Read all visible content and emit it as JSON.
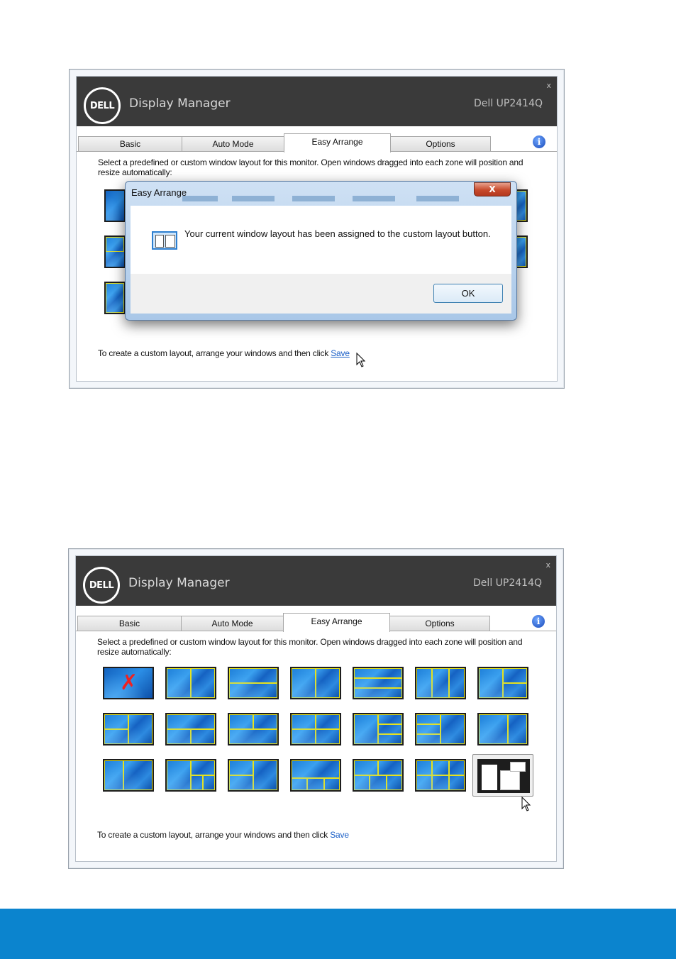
{
  "app": {
    "logo_text": "DELL",
    "title": "Display Manager",
    "model": "Dell UP2414Q",
    "close_glyph": "x"
  },
  "tabs": [
    {
      "label": "Basic"
    },
    {
      "label": "Auto Mode"
    },
    {
      "label": "Easy Arrange",
      "active": true
    },
    {
      "label": "Options"
    }
  ],
  "info_glyph": "i",
  "easy_arrange": {
    "description": "Select a predefined or custom window layout for this monitor. Open windows dragged into each zone will position and resize automatically:",
    "hint_prefix": "To create a custom layout, arrange your windows and then click ",
    "save_link": "Save"
  },
  "dialog": {
    "title": "Easy Arrange",
    "close_glyph": "X",
    "message": "Your current window layout has been assigned to the custom layout button.",
    "ok_label": "OK"
  },
  "layout_icons": [
    "no-layout-icon",
    "layout-2-col-icon",
    "layout-2-row-icon",
    "layout-2-col-alt-icon",
    "layout-3-row-icon",
    "layout-3-col-icon",
    "layout-3-split-right-icon",
    "layout-3-split-left-icon",
    "layout-3-split-top-icon",
    "layout-3-split-bottom-icon",
    "layout-4-grid-icon",
    "layout-4-right-stack-icon",
    "layout-4-left-stack-icon",
    "layout-2-col-wide-icon",
    "layout-2-col-narrow-icon",
    "layout-3-col-right-stack-icon",
    "layout-4-mixed-icon",
    "layout-5-bottom-icon",
    "layout-5-grid-icon",
    "layout-6-grid-icon",
    "custom-layout-icon"
  ],
  "colors": {
    "titlebar": "#3a3a3a",
    "zone_line": "#e7e21c",
    "link": "#1a5fc7",
    "footer_bar": "#0b84ce"
  }
}
